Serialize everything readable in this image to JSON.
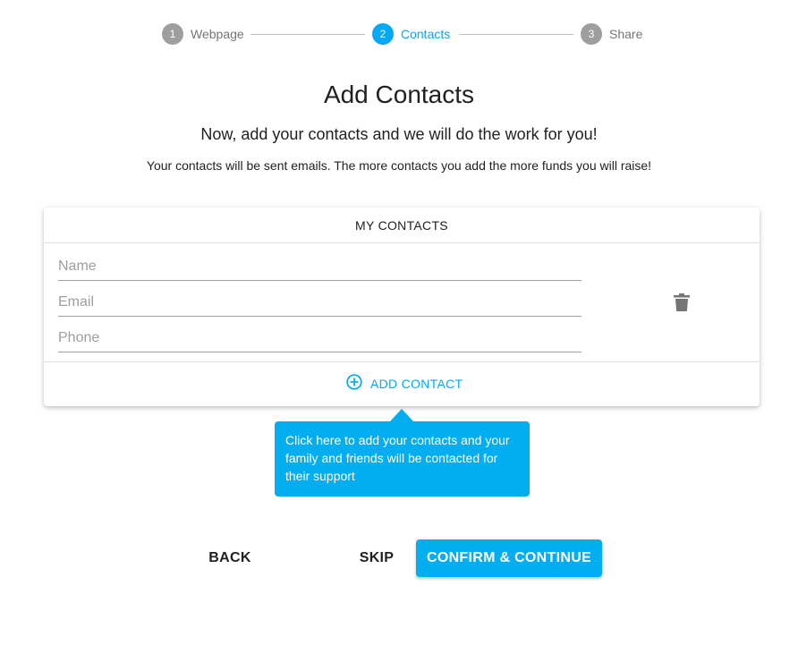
{
  "stepper": {
    "steps": [
      {
        "number": "1",
        "label": "Webpage",
        "active": false
      },
      {
        "number": "2",
        "label": "Contacts",
        "active": true
      },
      {
        "number": "3",
        "label": "Share",
        "active": false
      }
    ]
  },
  "page": {
    "title": "Add Contacts",
    "subtitle": "Now, add your contacts and we will do the work for you!",
    "description": "Your contacts will be sent emails. The more contacts you add the more funds you will raise!"
  },
  "contacts_card": {
    "header": "MY CONTACTS",
    "fields": {
      "name": {
        "value": "",
        "placeholder": "Name"
      },
      "email": {
        "value": "",
        "placeholder": "Email"
      },
      "phone": {
        "value": "",
        "placeholder": "Phone"
      }
    },
    "delete_icon": "trash-icon",
    "add_contact_label": "ADD CONTACT",
    "add_contact_icon": "add-circle-outline-icon"
  },
  "tooltip": {
    "text": "Click here to add your contacts and your family and friends will be contacted for their support"
  },
  "actions": {
    "back_label": "BACK",
    "skip_label": "SKIP",
    "confirm_label": "CONFIRM & CONTINUE"
  },
  "colors": {
    "accent": "#03a9f4",
    "inactive_step": "#9e9e9e",
    "text": "#212121"
  }
}
